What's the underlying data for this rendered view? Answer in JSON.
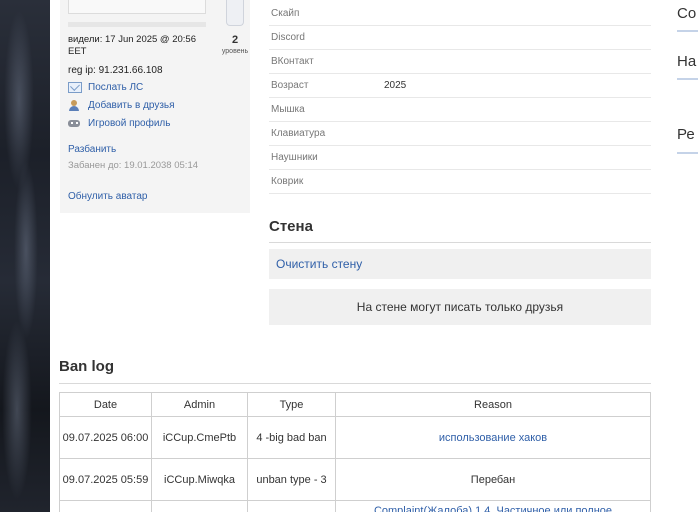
{
  "profile": {
    "last_seen": "видели: 17 Jun 2025 @ 20:56 EET",
    "level_value": "2",
    "level_label": "уровень",
    "reg_ip": "reg ip: 91.231.66.108",
    "actions": [
      {
        "label": "Послать ЛС",
        "icon": "mail-icon"
      },
      {
        "label": "Добавить в друзья",
        "icon": "add-friend-icon"
      },
      {
        "label": "Игровой профиль",
        "icon": "gamepad-icon"
      }
    ],
    "unban_label": "Разбанить",
    "banned_until": "Забанен до: 19.01.2038 05:14",
    "reset_avatar_label": "Обнулить аватар"
  },
  "info": [
    {
      "key": "Скайп",
      "value": ""
    },
    {
      "key": "Discord",
      "value": ""
    },
    {
      "key": "ВКонтакт",
      "value": ""
    },
    {
      "key": "Возраст",
      "value": "2025"
    },
    {
      "key": "Мышка",
      "value": ""
    },
    {
      "key": "Клавиатура",
      "value": ""
    },
    {
      "key": "Наушники",
      "value": ""
    },
    {
      "key": "Коврик",
      "value": ""
    }
  ],
  "wall": {
    "title": "Стена",
    "clear_label": "Очистить стену",
    "note": "На стене могут писать только друзья"
  },
  "ban_log": {
    "title": "Ban log",
    "headers": [
      "Date",
      "Admin",
      "Type",
      "Reason"
    ],
    "rows": [
      {
        "date": "09.07.2025 06:00",
        "admin": "iCCup.CmePtb",
        "type": "4 -big bad ban",
        "reason": "использование хаков",
        "reason_is_link": true
      },
      {
        "date": "09.07.2025 05:59",
        "admin": "iCCup.Miwqka",
        "type": "unban type - 3",
        "reason": "Перебан",
        "reason_is_link": false
      },
      {
        "date": "",
        "admin": "",
        "type": "",
        "reason": "Complaint(Жалоба) 1.4. Частичное или полное",
        "reason_is_link": true
      }
    ]
  },
  "right_column": {
    "items": [
      "Co",
      "На",
      "Ре"
    ]
  }
}
